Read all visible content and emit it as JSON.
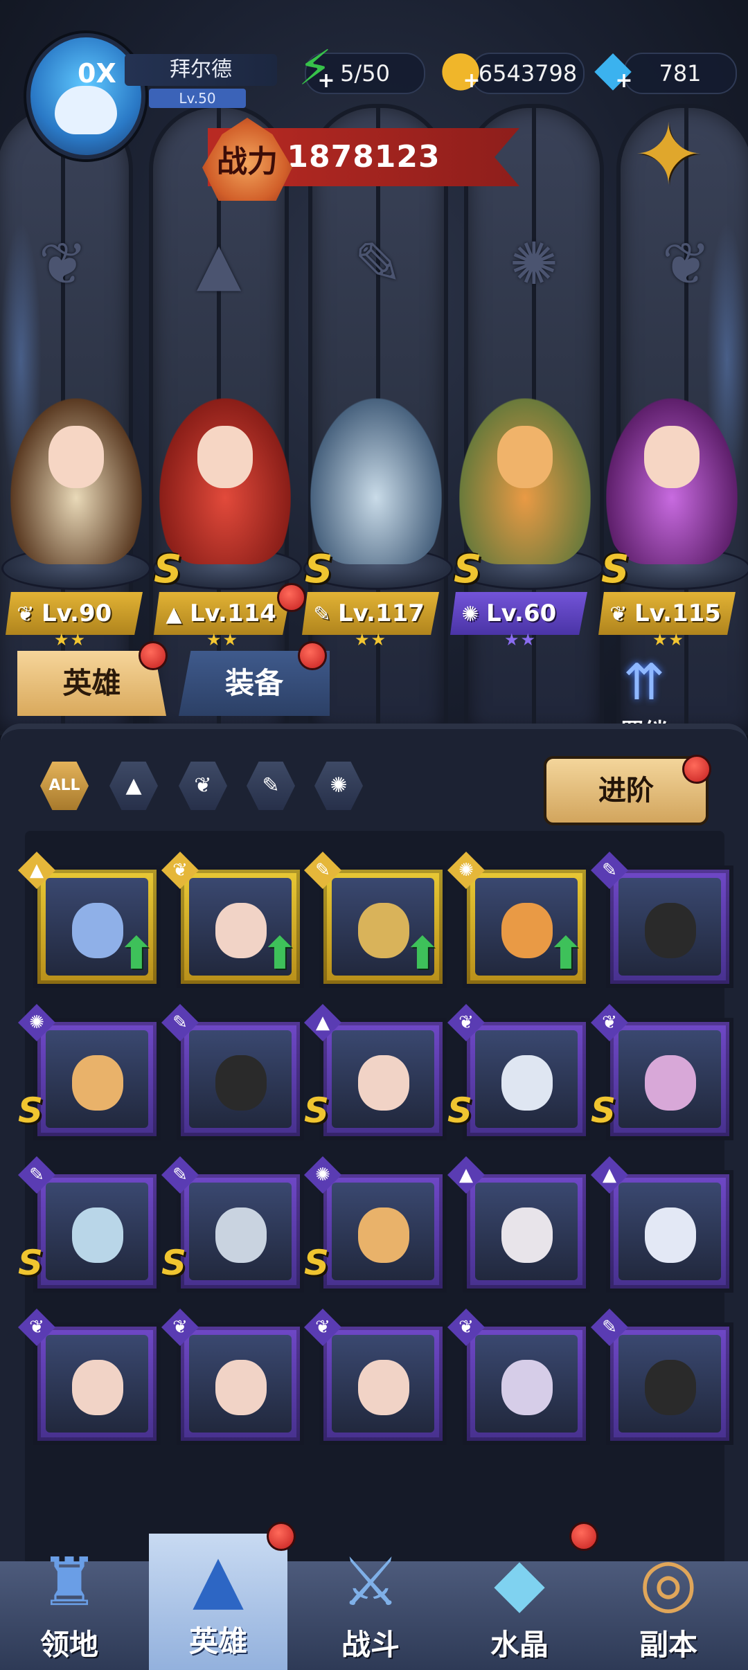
{
  "player": {
    "name": "拜尔德",
    "level": "Lv.50",
    "avatar_mark": "0X"
  },
  "resources": {
    "energy": "5/50",
    "gold": "6543798",
    "gems": "781"
  },
  "combat_power": {
    "label": "战力",
    "value": "1878123"
  },
  "class_symbols": [
    "wing-icon",
    "wizard-hat-icon",
    "wrench-icon",
    "beast-icon",
    "wing-icon"
  ],
  "lineup": [
    {
      "level": "Lv.90",
      "class": "wing",
      "rank": "",
      "stars": "★★",
      "tier": "gold"
    },
    {
      "level": "Lv.114",
      "class": "wizard",
      "rank": "S",
      "stars": "★★",
      "tier": "gold"
    },
    {
      "level": "Lv.117",
      "class": "wrench",
      "rank": "S",
      "stars": "★★",
      "tier": "gold"
    },
    {
      "level": "Lv.60",
      "class": "beast",
      "rank": "S",
      "stars": "★★",
      "tier": "purple"
    },
    {
      "level": "Lv.115",
      "class": "wing",
      "rank": "S",
      "stars": "★★",
      "tier": "gold"
    }
  ],
  "tabs": {
    "hero": "英雄",
    "equipment": "装备",
    "bond": "羁绊"
  },
  "filters": {
    "all": "ALL"
  },
  "advance_button": "进阶",
  "hero_cards": [
    {
      "frame": "gold",
      "class": "wizard",
      "rank": "",
      "upgrade": true
    },
    {
      "frame": "gold",
      "class": "wing",
      "rank": "",
      "upgrade": true
    },
    {
      "frame": "gold",
      "class": "wrench",
      "rank": "",
      "upgrade": true
    },
    {
      "frame": "gold",
      "class": "beast",
      "rank": "",
      "upgrade": true
    },
    {
      "frame": "purple",
      "class": "wrench",
      "rank": "",
      "upgrade": false
    },
    {
      "frame": "purple",
      "class": "beast",
      "rank": "S",
      "upgrade": false
    },
    {
      "frame": "purple",
      "class": "wrench",
      "rank": "",
      "upgrade": false
    },
    {
      "frame": "purple",
      "class": "wizard",
      "rank": "S",
      "upgrade": false
    },
    {
      "frame": "purple",
      "class": "wing",
      "rank": "S",
      "upgrade": false
    },
    {
      "frame": "purple",
      "class": "wing",
      "rank": "S",
      "upgrade": false
    },
    {
      "frame": "purple",
      "class": "wrench",
      "rank": "S",
      "upgrade": false
    },
    {
      "frame": "purple",
      "class": "wrench",
      "rank": "S",
      "upgrade": false
    },
    {
      "frame": "purple",
      "class": "beast",
      "rank": "S",
      "upgrade": false
    },
    {
      "frame": "purple",
      "class": "wizard",
      "rank": "",
      "upgrade": false
    },
    {
      "frame": "purple",
      "class": "wizard",
      "rank": "",
      "upgrade": false
    },
    {
      "frame": "purple",
      "class": "wing",
      "rank": "",
      "upgrade": false
    },
    {
      "frame": "purple",
      "class": "wing",
      "rank": "",
      "upgrade": false
    },
    {
      "frame": "purple",
      "class": "wing",
      "rank": "",
      "upgrade": false
    },
    {
      "frame": "purple",
      "class": "wing",
      "rank": "",
      "upgrade": false
    },
    {
      "frame": "purple",
      "class": "wrench",
      "rank": "",
      "upgrade": false
    }
  ],
  "nav": {
    "territory": "领地",
    "heroes": "英雄",
    "battle": "战斗",
    "crystal": "水晶",
    "dungeon": "副本"
  },
  "colors": {
    "gold_frame": "#e9c935",
    "purple_frame": "#6f48c7",
    "power_banner": "#b92a23",
    "notification": "#d8262a"
  }
}
